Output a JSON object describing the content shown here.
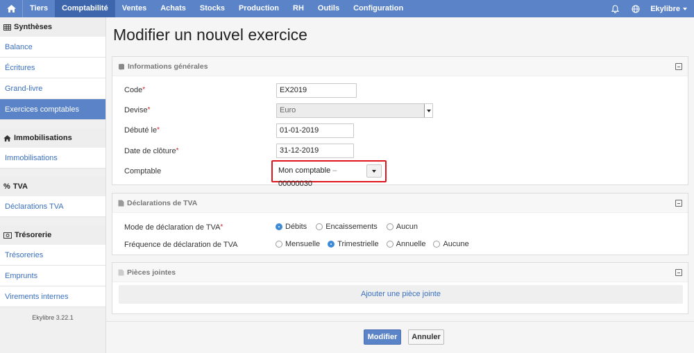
{
  "topnav": {
    "items": [
      "Tiers",
      "Comptabilité",
      "Ventes",
      "Achats",
      "Stocks",
      "Production",
      "RH",
      "Outils",
      "Configuration"
    ],
    "active": "Comptabilité",
    "user": "Ekylibre"
  },
  "sidebar": {
    "sections": [
      {
        "title": "Synthèses",
        "icon": "table-icon",
        "items": [
          "Balance",
          "Écritures",
          "Grand-livre",
          "Exercices comptables"
        ]
      },
      {
        "title": "Immobilisations",
        "icon": "home-icon",
        "items": [
          "Immobilisations"
        ]
      },
      {
        "title": "TVA",
        "icon": "percent-icon",
        "items": [
          "Déclarations TVA"
        ]
      },
      {
        "title": "Trésorerie",
        "icon": "money-icon",
        "items": [
          "Trésoreries",
          "Emprunts",
          "Virements internes"
        ]
      }
    ],
    "active_item": "Exercices comptables",
    "version": "Ekylibre 3.22.1"
  },
  "page": {
    "title": "Modifier un nouvel exercice"
  },
  "general": {
    "title": "Informations générales",
    "code_label": "Code",
    "code_value": "EX2019",
    "currency_label": "Devise",
    "currency_value": "Euro",
    "start_label": "Débuté le",
    "start_value": "01-01-2019",
    "end_label": "Date de clôture",
    "end_value": "31-12-2019",
    "accountant_label": "Comptable",
    "accountant_value": "Mon comptable",
    "accountant_sep": " – ",
    "accountant_code": "00000030",
    "required_mark": "*"
  },
  "vat": {
    "title": "Déclarations de TVA",
    "mode_label": "Mode de déclaration de TVA",
    "mode_options": [
      "Débits",
      "Encaissements",
      "Aucun"
    ],
    "mode_selected": 0,
    "freq_label": "Fréquence de déclaration de TVA",
    "freq_options": [
      "Mensuelle",
      "Trimestrielle",
      "Annuelle",
      "Aucune"
    ],
    "freq_selected": 1
  },
  "attachments": {
    "title": "Pièces jointes",
    "add_label": "Ajouter une pièce jointe"
  },
  "actions": {
    "submit": "Modifier",
    "cancel": "Annuler"
  },
  "colors": {
    "nav": "#5b83c7",
    "nav_active": "#3e66ad",
    "link": "#3a6fbf",
    "highlight": "#e0151b",
    "radio_on": "#3d8bd6"
  }
}
